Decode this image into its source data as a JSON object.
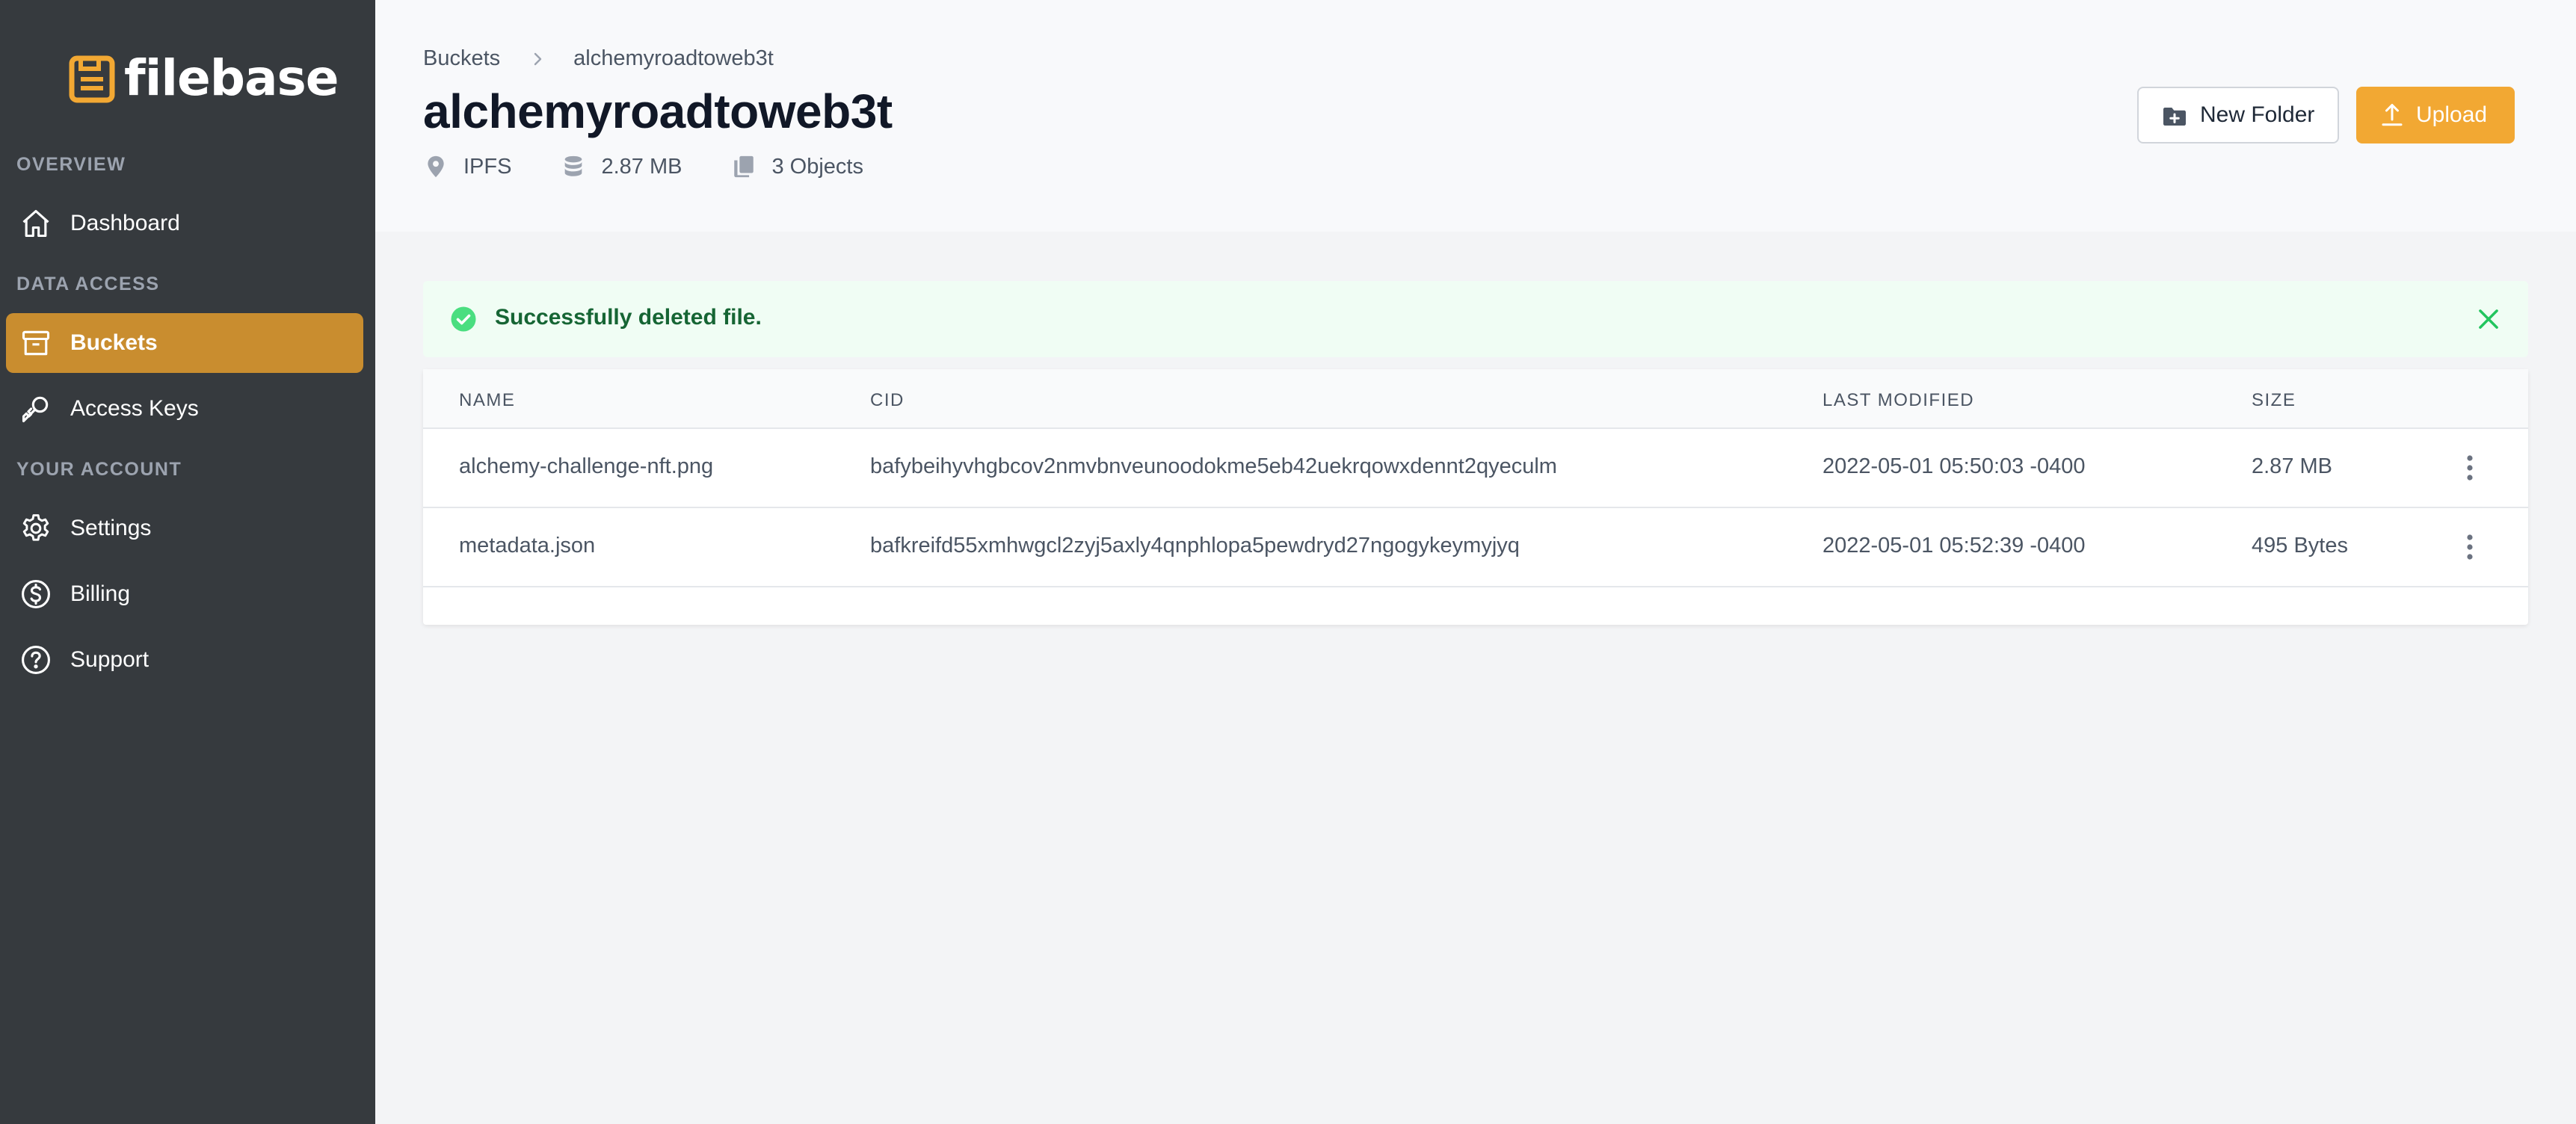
{
  "app": {
    "logo_text": "filebase",
    "brand_color": "#f2a833"
  },
  "sidebar": {
    "sections": [
      {
        "label": "OVERVIEW"
      },
      {
        "label": "DATA ACCESS"
      },
      {
        "label": "YOUR ACCOUNT"
      }
    ],
    "items": [
      {
        "label": "Dashboard",
        "icon": "home-icon"
      },
      {
        "label": "Buckets",
        "icon": "archive-box-icon",
        "active": true
      },
      {
        "label": "Access Keys",
        "icon": "key-icon"
      },
      {
        "label": "Settings",
        "icon": "gear-icon"
      },
      {
        "label": "Billing",
        "icon": "dollar-circle-icon"
      },
      {
        "label": "Support",
        "icon": "question-circle-icon"
      }
    ]
  },
  "breadcrumb": {
    "root": "Buckets",
    "current": "alchemyroadtoweb3t"
  },
  "bucket": {
    "title": "alchemyroadtoweb3t",
    "network": "IPFS",
    "size": "2.87 MB",
    "objects": "3 Objects"
  },
  "actions": {
    "new_folder": "New Folder",
    "upload": "Upload"
  },
  "alert": {
    "message": "Successfully deleted file.",
    "status_color": "#22c55e"
  },
  "table": {
    "headers": {
      "name": "NAME",
      "cid": "CID",
      "modified": "LAST MODIFIED",
      "size": "SIZE"
    },
    "rows": [
      {
        "name": "alchemy-challenge-nft.png",
        "cid": "bafybeihyvhgbcov2nmvbnveunoodokme5eb42uekrqowxdennt2qyeculm",
        "modified": "2022-05-01 05:50:03 -0400",
        "size": "2.87 MB"
      },
      {
        "name": "metadata.json",
        "cid": "bafkreifd55xmhwgcl2zyj5axly4qnphlopa5pewdryd27ngogykeymyjyq",
        "modified": "2022-05-01 05:52:39 -0400",
        "size": "495 Bytes"
      }
    ]
  }
}
